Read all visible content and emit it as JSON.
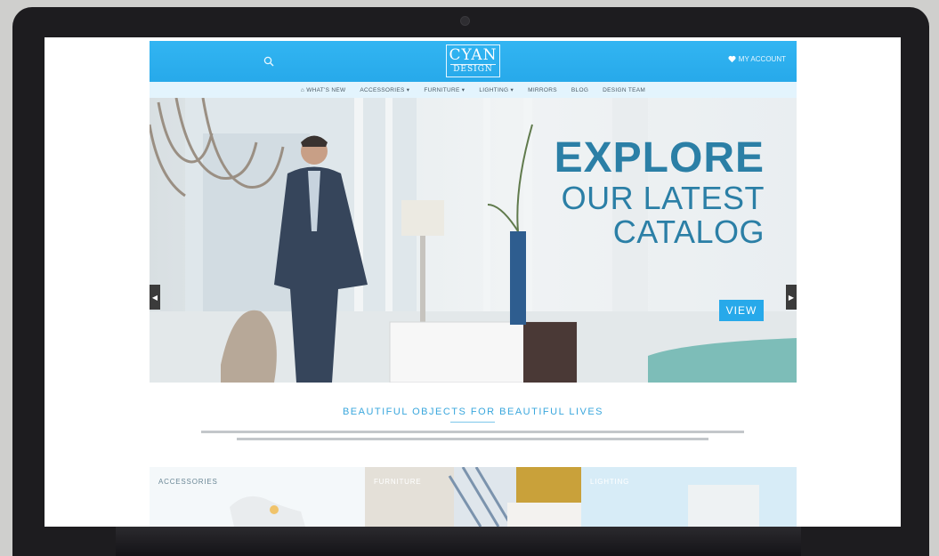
{
  "site": {
    "logo_line1": "CYAN",
    "logo_line2": "DESIGN",
    "account_label": "MY ACCOUNT"
  },
  "nav": {
    "items": [
      {
        "label": "WHAT'S NEW",
        "icon": "home-icon"
      },
      {
        "label": "ACCESSORIES"
      },
      {
        "label": "FURNITURE"
      },
      {
        "label": "LIGHTING"
      },
      {
        "label": "MIRRORS"
      },
      {
        "label": "BLOG"
      },
      {
        "label": "DESIGN TEAM"
      }
    ]
  },
  "hero": {
    "headline": "EXPLORE",
    "subline1": "OUR LATEST",
    "subline2": "CATALOG",
    "button_label": "VIEW"
  },
  "section": {
    "tagline": "BEAUTIFUL OBJECTS FOR BEAUTIFUL LIVES"
  },
  "categories": [
    {
      "label": "ACCESSORIES"
    },
    {
      "label": "FURNITURE"
    },
    {
      "label": "LIGHTING"
    }
  ],
  "colors": {
    "brand_blue": "#27a9ea",
    "headline_blue": "#2b7fa6",
    "nav_bg": "#e3f4fd"
  }
}
